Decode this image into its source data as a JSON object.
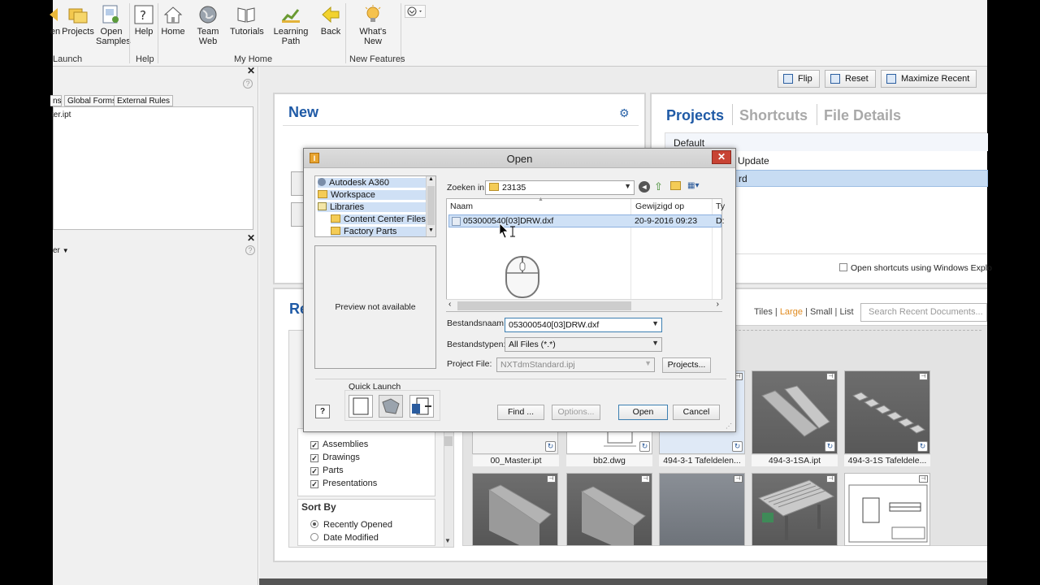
{
  "ribbon": {
    "buttons": [
      {
        "label": "en",
        "icon": "arrow-icon"
      },
      {
        "label": "Projects",
        "icon": "projects-icon"
      },
      {
        "label": "Open Samples",
        "icon": "open-samples-icon"
      },
      {
        "label": "Help",
        "icon": "help-icon"
      },
      {
        "label": "Home",
        "icon": "home-icon"
      },
      {
        "label": "Team Web",
        "icon": "globe-icon"
      },
      {
        "label": "Tutorials",
        "icon": "tutorials-icon"
      },
      {
        "label": "Learning Path",
        "icon": "learning-path-icon"
      },
      {
        "label": "Back",
        "icon": "back-arrow-icon"
      },
      {
        "label": "What's New",
        "icon": "lightbulb-icon"
      }
    ],
    "groups": [
      "Launch",
      "Help",
      "My Home",
      "New Features"
    ]
  },
  "left_panel": {
    "tabs": [
      "ns",
      "Global Forms",
      "External Rules"
    ],
    "file": "ter.ipt",
    "dropdown_label": "er"
  },
  "top_buttons": {
    "flip": "Flip",
    "reset": "Reset",
    "maximize": "Maximize Recent"
  },
  "new_panel": {
    "title": "New"
  },
  "projects_panel": {
    "tabs": [
      "Projects",
      "Shortcuts",
      "File Details"
    ],
    "items": [
      "Default",
      "Update",
      "rd"
    ],
    "checkbox_label": "Open shortcuts using Windows Explo"
  },
  "recent_panel": {
    "title": "Re",
    "view_links": {
      "tiles": "Tiles",
      "large": "Large",
      "small": "Small",
      "list": "List",
      "sep": "|"
    },
    "search_placeholder": "Search Recent Documents...",
    "filters": [
      "Assemblies",
      "Drawings",
      "Parts",
      "Presentations"
    ],
    "sort_by_label": "Sort By",
    "sort_options": [
      {
        "label": "Recently Opened",
        "selected": true
      },
      {
        "label": "Date Modified",
        "selected": false
      }
    ],
    "thumbnails_row1": [
      "00_Master.ipt",
      "bb2.dwg",
      "494-3-1 Tafeldelen...",
      "494-3-1SA.ipt",
      "494-3-1S Tafeldele..."
    ]
  },
  "dialog": {
    "title": "Open",
    "locations": [
      "Autodesk A360",
      "Workspace",
      "Libraries",
      "Content Center Files",
      "Factory Parts"
    ],
    "preview_text": "Preview not available",
    "look_in_label": "Zoeken in:",
    "look_in_value": "23135",
    "columns": {
      "name": "Naam",
      "modified": "Gewijzigd op",
      "type": "Ty"
    },
    "file": {
      "name": "053000540[03]DRW.dxf",
      "modified": "20-9-2016 09:23",
      "type": "D:"
    },
    "filename_label": "Bestandsnaam:",
    "filename_value": "053000540[03]DRW.dxf",
    "filetype_label": "Bestandstypen:",
    "filetype_value": "All Files (*.*)",
    "project_label": "Project File:",
    "project_value": "NXTdmStandard.ipj",
    "projects_button": "Projects...",
    "quick_launch_label": "Quick Launch",
    "find_button": "Find ...",
    "options_button": "Options...",
    "open_button": "Open",
    "cancel_button": "Cancel"
  },
  "colors": {
    "accent_blue": "#1f5aa6",
    "selection": "#cfe1f6",
    "close_red": "#c84334",
    "orange_link": "#e08a1e"
  }
}
